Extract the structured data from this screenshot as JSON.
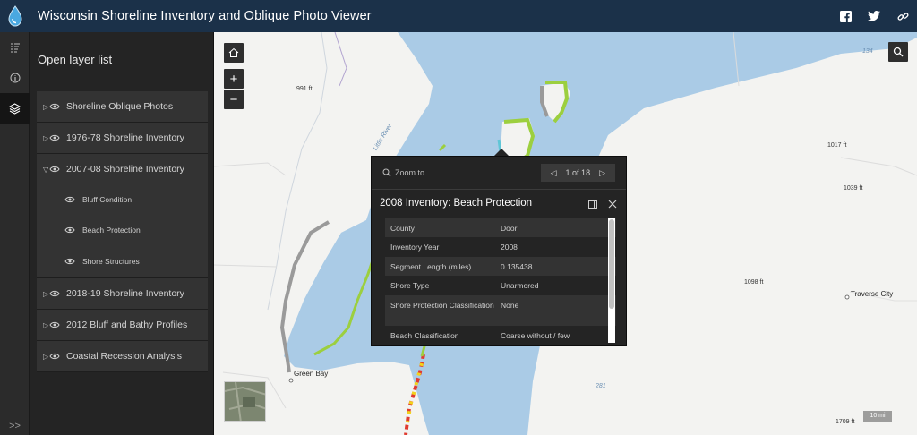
{
  "header": {
    "title": "Wisconsin Shoreline Inventory and Oblique Photo Viewer",
    "logo_icon": "water-drop-icon",
    "social": [
      "facebook-icon",
      "twitter-icon",
      "link-icon"
    ]
  },
  "iconbar": {
    "items": [
      "legend-icon",
      "info-icon",
      "layers-icon"
    ],
    "active": "layers-icon",
    "expand_label": ">>"
  },
  "layer_panel": {
    "title": "Open layer list",
    "layers": [
      {
        "label": "Shoreline Oblique Photos",
        "expanded": false
      },
      {
        "label": "1976-78 Shoreline Inventory",
        "expanded": false
      },
      {
        "label": "2007-08 Shoreline Inventory",
        "expanded": true,
        "sublayers": [
          "Bluff Condition",
          "Beach Protection",
          "Shore Structures"
        ]
      },
      {
        "label": "2018-19 Shoreline Inventory",
        "expanded": false
      },
      {
        "label": "2012 Bluff and Bathy Profiles",
        "expanded": false
      },
      {
        "label": "Coastal Recession Analysis",
        "expanded": false
      }
    ]
  },
  "map": {
    "labels": {
      "elev_991": "991 ft",
      "elev_1017": "1017 ft",
      "elev_1039": "1039 ft",
      "elev_1098": "1098 ft",
      "elev_1709": "1709 ft",
      "water_134": "134",
      "water_281": "281",
      "river": "Little River",
      "green_bay": "Green Bay",
      "traverse": "Traverse City"
    },
    "scale": "10 mi",
    "colors": {
      "water": "#aacbe6",
      "land": "#f3f3f1",
      "shore_green": "#9ccf3f",
      "shore_gray": "#9a9a9a",
      "shore_red": "#e03a2f",
      "shore_yellow": "#f2d21b"
    }
  },
  "popup": {
    "zoom_to": "Zoom to",
    "pager": "1 of 18",
    "title": "2008 Inventory: Beach Protection",
    "rows": [
      {
        "k": "County",
        "v": "Door"
      },
      {
        "k": "Inventory Year",
        "v": "2008"
      },
      {
        "k": "Segment Length (miles)",
        "v": "0.135438"
      },
      {
        "k": "Shore Type",
        "v": "Unarmored"
      },
      {
        "k": "Shore Protection Classification",
        "v": "None"
      },
      {
        "k": "Beach Classification",
        "v": "Coarse without / few"
      }
    ]
  }
}
